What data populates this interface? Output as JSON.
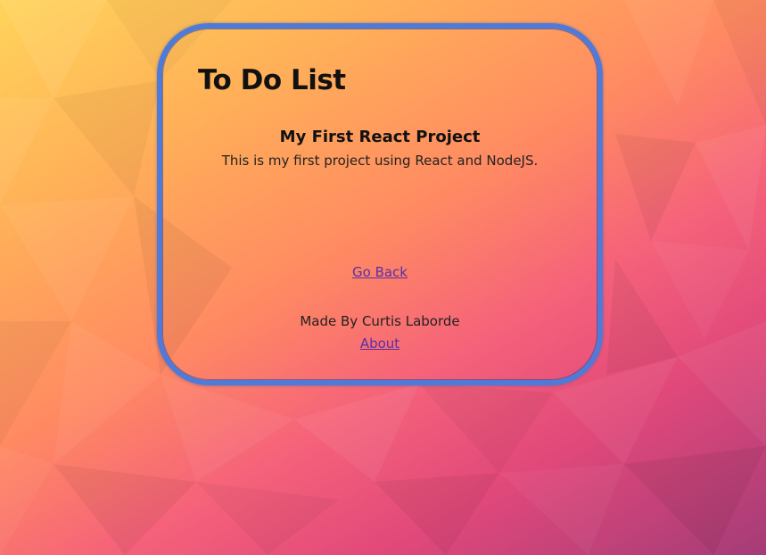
{
  "header": {
    "title": "To Do List"
  },
  "project": {
    "title": "My First React Project",
    "description": "This is my first project using React and NodeJS."
  },
  "nav": {
    "go_back_label": "Go Back"
  },
  "footer": {
    "made_by": "Made By Curtis Laborde",
    "about_label": "About"
  },
  "colors": {
    "card_border": "#4f7ad8",
    "link": "#5a2fa5"
  }
}
